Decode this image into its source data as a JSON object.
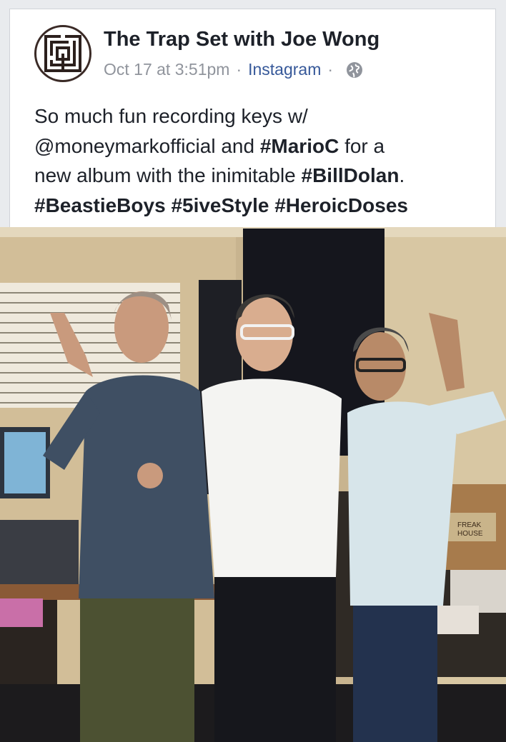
{
  "post": {
    "author": "The Trap Set with Joe Wong",
    "date": "Oct 17 at 3:51pm",
    "separator": "·",
    "source": "Instagram",
    "privacy_icon": "globe-icon",
    "text_lines": [
      {
        "plain_before": "So much fun recording keys w/",
        "tag": "",
        "plain_after": ""
      },
      {
        "plain_before": "@moneymarkofficial and ",
        "tag": "#MarioC",
        "plain_after": " for a"
      },
      {
        "plain_before": "new album with the inimitable ",
        "tag": "#BillDolan",
        "plain_after": "."
      }
    ],
    "hashtags_line": [
      "#BeastieBoys",
      "#5iveStyle",
      "#HeroicDoses"
    ]
  },
  "photo": {
    "description_icon": "photo",
    "sign_text_1": "FREAK",
    "sign_text_2": "HOUSE"
  },
  "colors": {
    "link": "#365899",
    "text": "#1d2129",
    "meta": "#90949c"
  }
}
